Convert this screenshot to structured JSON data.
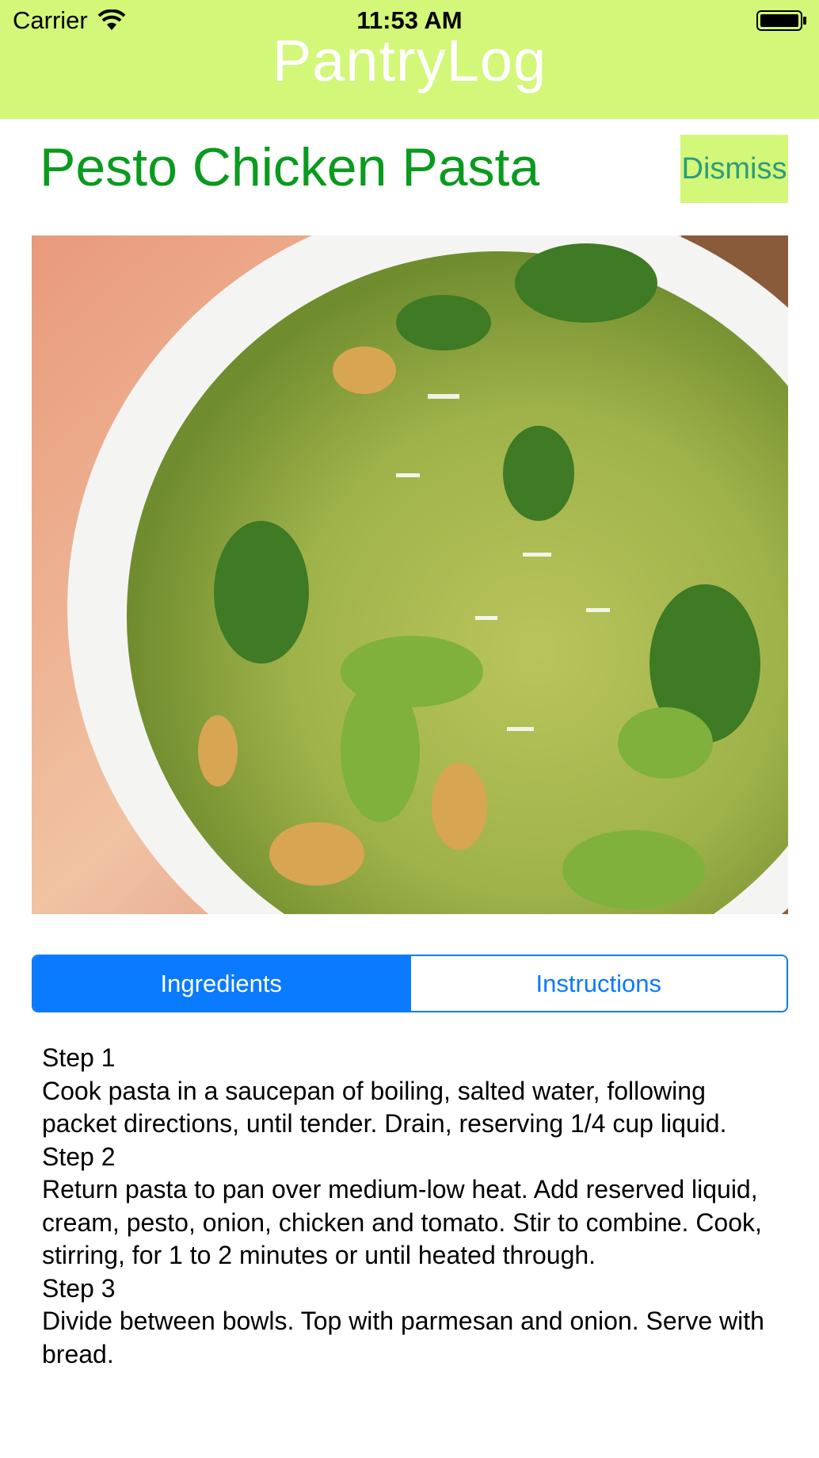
{
  "status_bar": {
    "carrier": "Carrier",
    "time": "11:53 AM"
  },
  "header": {
    "title": "PantryLog"
  },
  "recipe": {
    "title": "Pesto Chicken Pasta",
    "dismiss_label": "Dismiss"
  },
  "tabs": [
    {
      "label": "Ingredients",
      "selected": true
    },
    {
      "label": "Instructions",
      "selected": false
    }
  ],
  "instructions": [
    "Step 1",
    "Cook pasta in a saucepan of boiling, salted water, following packet directions, until tender. Drain, reserving 1/4 cup liquid.",
    "Step 2",
    "Return pasta to pan over medium-low heat. Add reserved liquid, cream, pesto, onion, chicken and tomato. Stir to combine. Cook, stirring, for 1 to 2 minutes or until heated through.",
    "Step 3",
    "Divide between bowls. Top with parmesan and onion. Serve with bread."
  ],
  "colors": {
    "header_bg": "#d3f779",
    "title_green": "#0a9a1e",
    "dismiss_text": "#2c9c7d",
    "accent_blue": "#0a7aff"
  }
}
